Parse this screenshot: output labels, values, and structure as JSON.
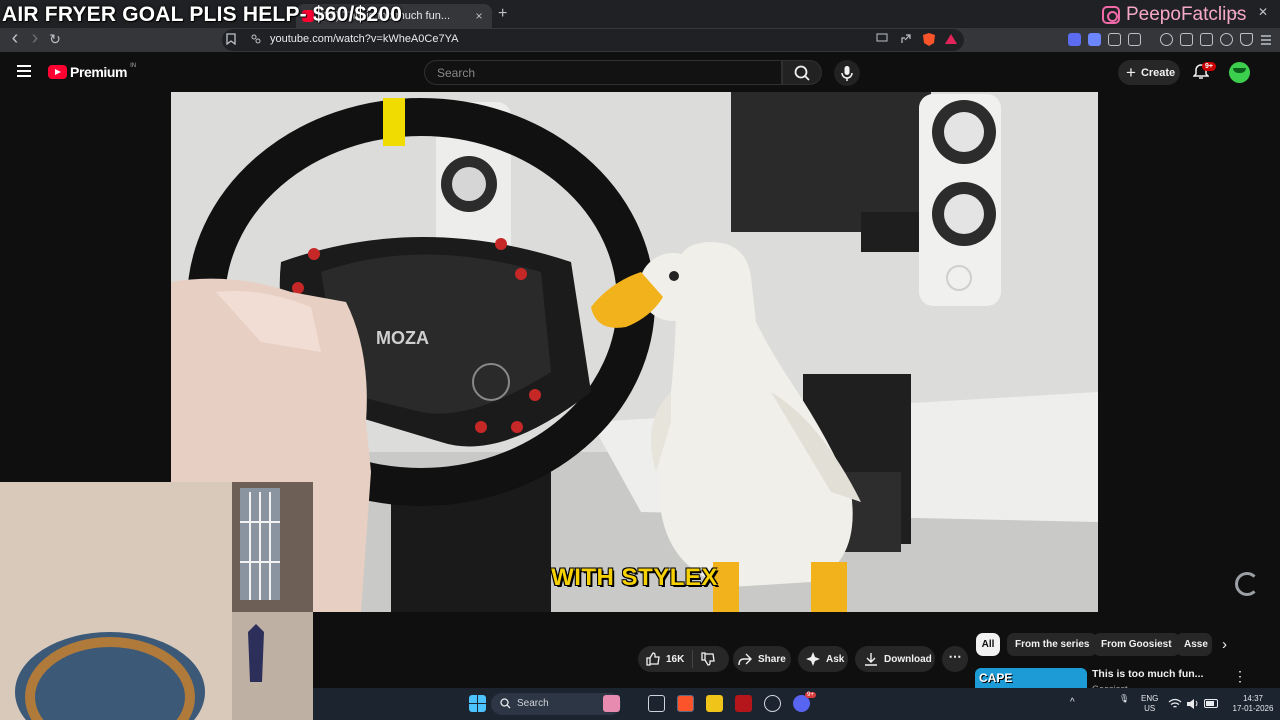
{
  "browser": {
    "tab": {
      "title": "(35) This is too much fun...",
      "close": "×"
    },
    "new_tab": "+",
    "window_controls": {
      "minimize": "–",
      "close": "✕"
    },
    "url": "youtube.com/watch?v=kWheA0Ce7YA",
    "nav": {
      "back": "‹",
      "forward": "›",
      "reload": "↻"
    }
  },
  "overlay": {
    "goal_text": "AIR FRYER GOAL PLIS HELP- $60/$200",
    "instagram_handle": "PeepoFatclips"
  },
  "youtube": {
    "logo_text": "Premium",
    "country_code": "IN",
    "search_placeholder": "Search",
    "create_label": "Create",
    "notifications_badge": "9+"
  },
  "video": {
    "subtitle": "WITH STYLEX",
    "wheel_brand": "MOZA"
  },
  "actions": {
    "like_count": "16K",
    "share": "Share",
    "ask": "Ask",
    "download": "Download",
    "more": "⋯"
  },
  "chips": [
    "All",
    "From the series",
    "From Goosiest",
    "Asse"
  ],
  "recommendation": {
    "thumb_text": "CAPE",
    "title": "This is too much fun...",
    "channel": "Goosiest"
  },
  "taskbar": {
    "search_label": "Search",
    "language": {
      "lang": "ENG",
      "region": "US"
    },
    "time": "14:37",
    "date": "17-01-2026",
    "discord_badge": "9+"
  },
  "colors": {
    "youtube_red": "#ff0033",
    "background": "#0f0f0f",
    "subtitle_yellow": "#f6d000",
    "accent_pink": "#f7a8c7"
  }
}
